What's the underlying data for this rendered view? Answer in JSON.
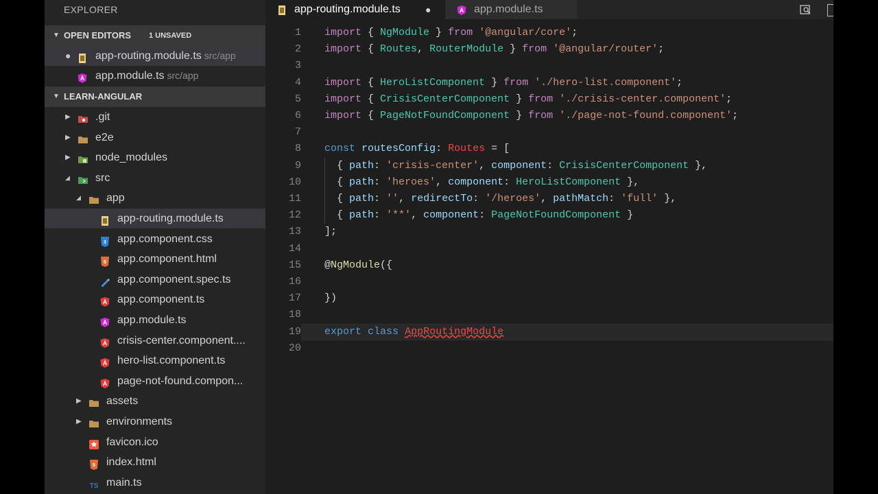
{
  "sidebar": {
    "title": "EXPLORER",
    "open_editors": {
      "label": "OPEN EDITORS",
      "badge": "1 UNSAVED",
      "items": [
        {
          "name": "app-routing.module.ts",
          "path": "src/app",
          "icon": "typescript-file-icon",
          "modified": true
        },
        {
          "name": "app.module.ts",
          "path": "src/app",
          "icon": "angular-file-icon",
          "modified": false
        }
      ]
    },
    "project": {
      "label": "LEARN-ANGULAR",
      "items": [
        {
          "name": ".git",
          "icon": "git-folder-icon",
          "expanded": false,
          "depth": 0,
          "folder": true
        },
        {
          "name": "e2e",
          "icon": "folder-icon",
          "expanded": false,
          "depth": 0,
          "folder": true
        },
        {
          "name": "node_modules",
          "icon": "node-folder-icon",
          "expanded": false,
          "depth": 0,
          "folder": true
        },
        {
          "name": "src",
          "icon": "src-folder-icon",
          "expanded": true,
          "depth": 0,
          "folder": true
        },
        {
          "name": "app",
          "icon": "folder-icon",
          "expanded": true,
          "depth": 1,
          "folder": true
        },
        {
          "name": "app-routing.module.ts",
          "icon": "typescript-file-icon",
          "depth": 2,
          "selected": true
        },
        {
          "name": "app.component.css",
          "icon": "css-file-icon",
          "depth": 2
        },
        {
          "name": "app.component.html",
          "icon": "html-file-icon",
          "depth": 2
        },
        {
          "name": "app.component.spec.ts",
          "icon": "spec-file-icon",
          "depth": 2
        },
        {
          "name": "app.component.ts",
          "icon": "angular-component-icon",
          "depth": 2
        },
        {
          "name": "app.module.ts",
          "icon": "angular-file-icon",
          "depth": 2
        },
        {
          "name": "crisis-center.component....",
          "icon": "angular-component-icon",
          "depth": 2
        },
        {
          "name": "hero-list.component.ts",
          "icon": "angular-component-icon",
          "depth": 2
        },
        {
          "name": "page-not-found.compon...",
          "icon": "angular-component-icon",
          "depth": 2
        },
        {
          "name": "assets",
          "icon": "folder-icon",
          "expanded": false,
          "depth": 1,
          "folder": true
        },
        {
          "name": "environments",
          "icon": "folder-icon",
          "expanded": false,
          "depth": 1,
          "folder": true
        },
        {
          "name": "favicon.ico",
          "icon": "favicon-file-icon",
          "depth": 1
        },
        {
          "name": "index.html",
          "icon": "html-file-icon",
          "depth": 1
        },
        {
          "name": "main.ts",
          "icon": "ts-file-icon",
          "depth": 1
        }
      ]
    }
  },
  "tabs": [
    {
      "name": "app-routing.module.ts",
      "icon": "typescript-file-icon",
      "active": true,
      "modified": true
    },
    {
      "name": "app.module.ts",
      "icon": "angular-file-icon",
      "active": false
    }
  ],
  "editor": {
    "current_line": 19,
    "lines": [
      [
        [
          "kw",
          "import"
        ],
        [
          "punc",
          " { "
        ],
        [
          "cls",
          "NgModule"
        ],
        [
          "punc",
          " } "
        ],
        [
          "kw",
          "from"
        ],
        [
          "punc",
          " "
        ],
        [
          "str",
          "'@angular/core'"
        ],
        [
          "punc",
          ";"
        ]
      ],
      [
        [
          "kw",
          "import"
        ],
        [
          "punc",
          " { "
        ],
        [
          "cls",
          "Routes"
        ],
        [
          "punc",
          ", "
        ],
        [
          "cls",
          "RouterModule"
        ],
        [
          "punc",
          " } "
        ],
        [
          "kw",
          "from"
        ],
        [
          "punc",
          " "
        ],
        [
          "str",
          "'@angular/router'"
        ],
        [
          "punc",
          ";"
        ]
      ],
      [],
      [
        [
          "kw",
          "import"
        ],
        [
          "punc",
          " { "
        ],
        [
          "cls",
          "HeroListComponent"
        ],
        [
          "punc",
          " } "
        ],
        [
          "kw",
          "from"
        ],
        [
          "punc",
          " "
        ],
        [
          "str",
          "'./hero-list.component'"
        ],
        [
          "punc",
          ";"
        ]
      ],
      [
        [
          "kw",
          "import"
        ],
        [
          "punc",
          " { "
        ],
        [
          "cls",
          "CrisisCenterComponent"
        ],
        [
          "punc",
          " } "
        ],
        [
          "kw",
          "from"
        ],
        [
          "punc",
          " "
        ],
        [
          "str",
          "'./crisis-center.component'"
        ],
        [
          "punc",
          ";"
        ]
      ],
      [
        [
          "kw",
          "import"
        ],
        [
          "punc",
          " { "
        ],
        [
          "cls",
          "PageNotFoundComponent"
        ],
        [
          "punc",
          " } "
        ],
        [
          "kw",
          "from"
        ],
        [
          "punc",
          " "
        ],
        [
          "str",
          "'./page-not-found.component'"
        ],
        [
          "punc",
          ";"
        ]
      ],
      [],
      [
        [
          "kw2",
          "const"
        ],
        [
          "punc",
          " "
        ],
        [
          "var",
          "routesConfig"
        ],
        [
          "punc",
          ": "
        ],
        [
          "type",
          "Routes"
        ],
        [
          "punc",
          " = ["
        ]
      ],
      [
        [
          "punc",
          "  { "
        ],
        [
          "prop",
          "path"
        ],
        [
          "punc",
          ": "
        ],
        [
          "str",
          "'crisis-center'"
        ],
        [
          "punc",
          ", "
        ],
        [
          "prop",
          "component"
        ],
        [
          "punc",
          ": "
        ],
        [
          "cls",
          "CrisisCenterComponent"
        ],
        [
          "punc",
          " },"
        ]
      ],
      [
        [
          "punc",
          "  { "
        ],
        [
          "prop",
          "path"
        ],
        [
          "punc",
          ": "
        ],
        [
          "str",
          "'heroes'"
        ],
        [
          "punc",
          ", "
        ],
        [
          "prop",
          "component"
        ],
        [
          "punc",
          ": "
        ],
        [
          "cls",
          "HeroListComponent"
        ],
        [
          "punc",
          " },"
        ]
      ],
      [
        [
          "punc",
          "  { "
        ],
        [
          "prop",
          "path"
        ],
        [
          "punc",
          ": "
        ],
        [
          "str",
          "''"
        ],
        [
          "punc",
          ", "
        ],
        [
          "prop",
          "redirectTo"
        ],
        [
          "punc",
          ": "
        ],
        [
          "str",
          "'/heroes'"
        ],
        [
          "punc",
          ", "
        ],
        [
          "prop",
          "pathMatch"
        ],
        [
          "punc",
          ": "
        ],
        [
          "str",
          "'full'"
        ],
        [
          "punc",
          " },"
        ]
      ],
      [
        [
          "punc",
          "  { "
        ],
        [
          "prop",
          "path"
        ],
        [
          "punc",
          ": "
        ],
        [
          "str",
          "'**'"
        ],
        [
          "punc",
          ", "
        ],
        [
          "prop",
          "component"
        ],
        [
          "punc",
          ": "
        ],
        [
          "cls",
          "PageNotFoundComponent"
        ],
        [
          "punc",
          " }"
        ]
      ],
      [
        [
          "punc",
          "];"
        ]
      ],
      [],
      [
        [
          "punc",
          "@"
        ],
        [
          "dec",
          "NgModule"
        ],
        [
          "punc",
          "({"
        ]
      ],
      [],
      [
        [
          "punc",
          "})"
        ]
      ],
      [],
      [
        [
          "kw2",
          "export"
        ],
        [
          "punc",
          " "
        ],
        [
          "kw2",
          "class"
        ],
        [
          "punc",
          " "
        ],
        [
          "err",
          "AppRoutingModule"
        ]
      ],
      []
    ]
  }
}
